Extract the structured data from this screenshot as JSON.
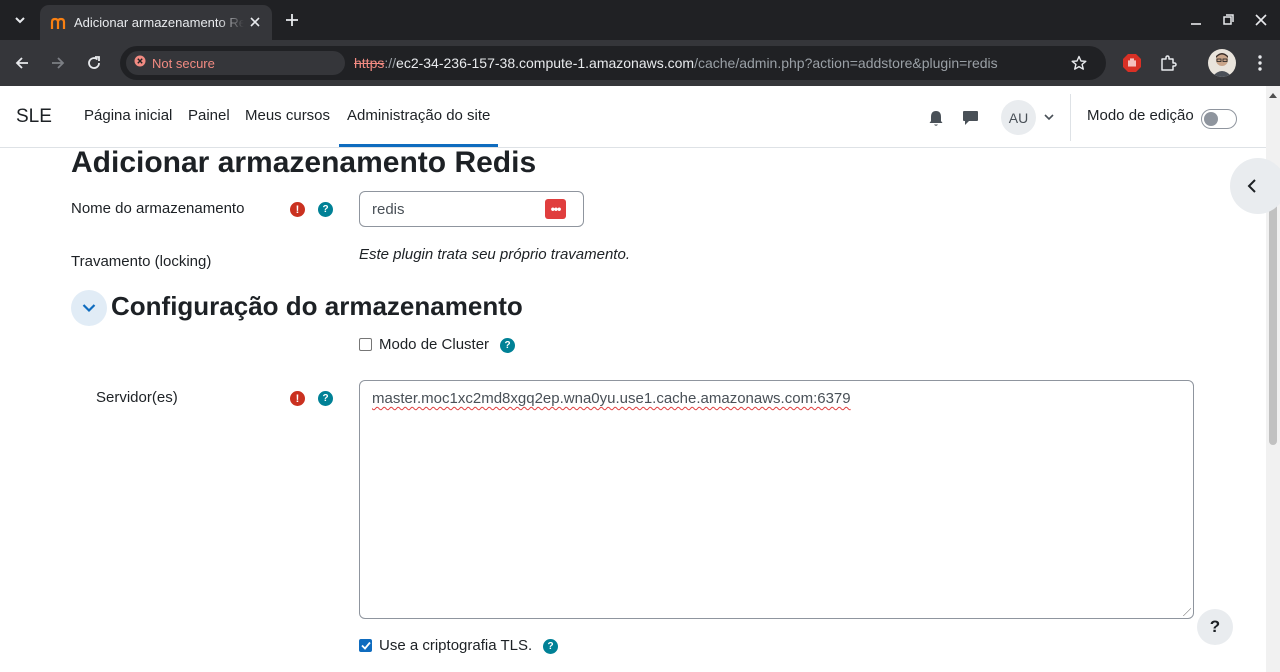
{
  "browser": {
    "tab_title": "Adicionar armazenamento Redis",
    "security_chip": "Not secure",
    "url_scheme": "https",
    "url_sep": "://",
    "url_host": "ec2-34-236-157-38.compute-1.amazonaws.com",
    "url_path": "/cache/admin.php?action=addstore&plugin=redis"
  },
  "site_nav": {
    "brand": "SLE",
    "items": [
      {
        "label": "Página inicial"
      },
      {
        "label": "Painel"
      },
      {
        "label": "Meus cursos"
      },
      {
        "label": "Administração do site",
        "active": true
      }
    ],
    "avatar_initials": "AU",
    "edit_mode_label": "Modo de edição",
    "edit_mode_on": false
  },
  "page": {
    "title": "Adicionar armazenamento Redis"
  },
  "form": {
    "store_name_label": "Nome do armazenamento",
    "store_name_value": "redis",
    "locking_label": "Travamento (locking)",
    "locking_text": "Este plugin trata seu próprio travamento.",
    "section_title": "Configuração do armazenamento",
    "cluster_mode_label": "Modo de Cluster",
    "cluster_mode_checked": false,
    "servers_label": "Servidor(es)",
    "servers_value": "master.moc1xc2md8xgq2ep.wna0yu.use1.cache.amazonaws.com:6379",
    "tls_label": "Use a criptografia TLS.",
    "tls_checked": true
  },
  "help_fab": "?",
  "colors": {
    "brand_primary": "#0f6cbf",
    "required": "#ca3120",
    "help": "#008196",
    "chrome_dark": "#202124",
    "chrome_toolbar": "#35363a"
  },
  "icons": {
    "required": "exclamation-circle-icon",
    "help": "question-circle-icon"
  }
}
